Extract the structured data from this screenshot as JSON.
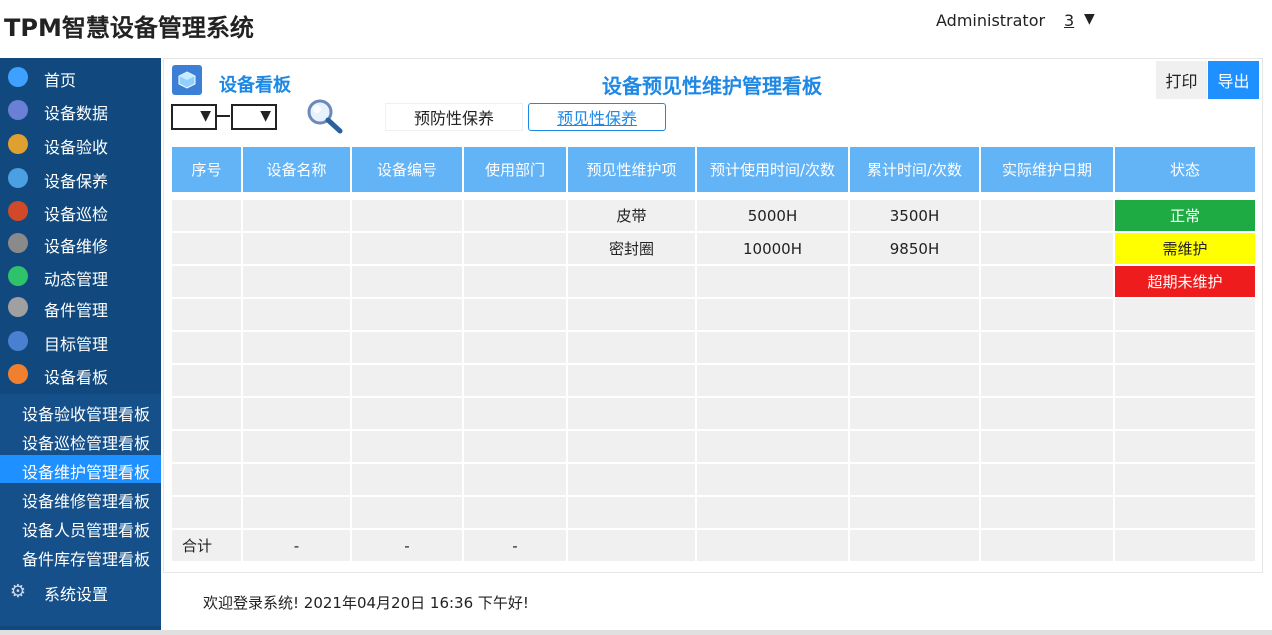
{
  "header": {
    "title": "TPM智慧设备管理系统",
    "user": "Administrator",
    "notifications": "3",
    "caret": "▼"
  },
  "sidebar": {
    "items": [
      {
        "label": "首页",
        "icon": "home-icon",
        "color": "#3ea1ff"
      },
      {
        "label": "设备数据",
        "icon": "monitor-icon",
        "color": "#6a7fd6"
      },
      {
        "label": "设备验收",
        "icon": "clipboard-icon",
        "color": "#e0a030"
      },
      {
        "label": "设备保养",
        "icon": "spray-icon",
        "color": "#4aa0e0"
      },
      {
        "label": "设备巡检",
        "icon": "checklist-icon",
        "color": "#d04a2a"
      },
      {
        "label": "设备维修",
        "icon": "wrench-icon",
        "color": "#8a8a8a"
      },
      {
        "label": "动态管理",
        "icon": "share-icon",
        "color": "#2ec26b"
      },
      {
        "label": "备件管理",
        "icon": "calendar-icon",
        "color": "#a0a0a0"
      },
      {
        "label": "目标管理",
        "icon": "target-icon",
        "color": "#4a80d0"
      },
      {
        "label": "设备看板",
        "icon": "board-icon",
        "color": "#f08030"
      }
    ],
    "submenu": [
      {
        "label": "设备验收管理看板"
      },
      {
        "label": "设备巡检管理看板"
      },
      {
        "label": "设备维护管理看板",
        "active": true
      },
      {
        "label": "设备维修管理看板"
      },
      {
        "label": "设备人员管理看板"
      },
      {
        "label": "备件库存管理看板"
      }
    ],
    "settings": {
      "label": "系统设置",
      "icon": "gear-icon"
    }
  },
  "content": {
    "board_label": "设备看板",
    "heading": "设备预见性维护管理看板",
    "print_label": "打印",
    "export_label": "导出",
    "select_arrow": "▼",
    "tabs": [
      {
        "label": "预防性保养"
      },
      {
        "label": "预见性保养"
      }
    ]
  },
  "table": {
    "columns": [
      "序号",
      "设备名称",
      "设备编号",
      "使用部门",
      "预见性维护项",
      "预计使用时间/次数",
      "累计时间/次数",
      "实际维护日期",
      "状态"
    ],
    "rows": [
      [
        "",
        "",
        "",
        "",
        "皮带",
        "5000H",
        "3500H",
        "",
        "正常"
      ],
      [
        "",
        "",
        "",
        "",
        "密封圈",
        "10000H",
        "9850H",
        "",
        "需维护"
      ],
      [
        "",
        "",
        "",
        "",
        "",
        "",
        "",
        "",
        "超期未维护"
      ],
      [
        "",
        "",
        "",
        "",
        "",
        "",
        "",
        "",
        ""
      ],
      [
        "",
        "",
        "",
        "",
        "",
        "",
        "",
        "",
        ""
      ],
      [
        "",
        "",
        "",
        "",
        "",
        "",
        "",
        "",
        ""
      ],
      [
        "",
        "",
        "",
        "",
        "",
        "",
        "",
        "",
        ""
      ],
      [
        "",
        "",
        "",
        "",
        "",
        "",
        "",
        "",
        ""
      ],
      [
        "",
        "",
        "",
        "",
        "",
        "",
        "",
        "",
        ""
      ],
      [
        "",
        "",
        "",
        "",
        "",
        "",
        "",
        "",
        ""
      ],
      [
        "合计",
        "-",
        "-",
        "-",
        "",
        "",
        "",
        "",
        ""
      ]
    ],
    "status_colors": {
      "正常": "#1fab44",
      "需维护": "#ffff00",
      "超期未维护": "#ee1c1c"
    }
  },
  "footer": {
    "text": "欢迎登录系统!  2021年04月20日 16:36 下午好!"
  }
}
